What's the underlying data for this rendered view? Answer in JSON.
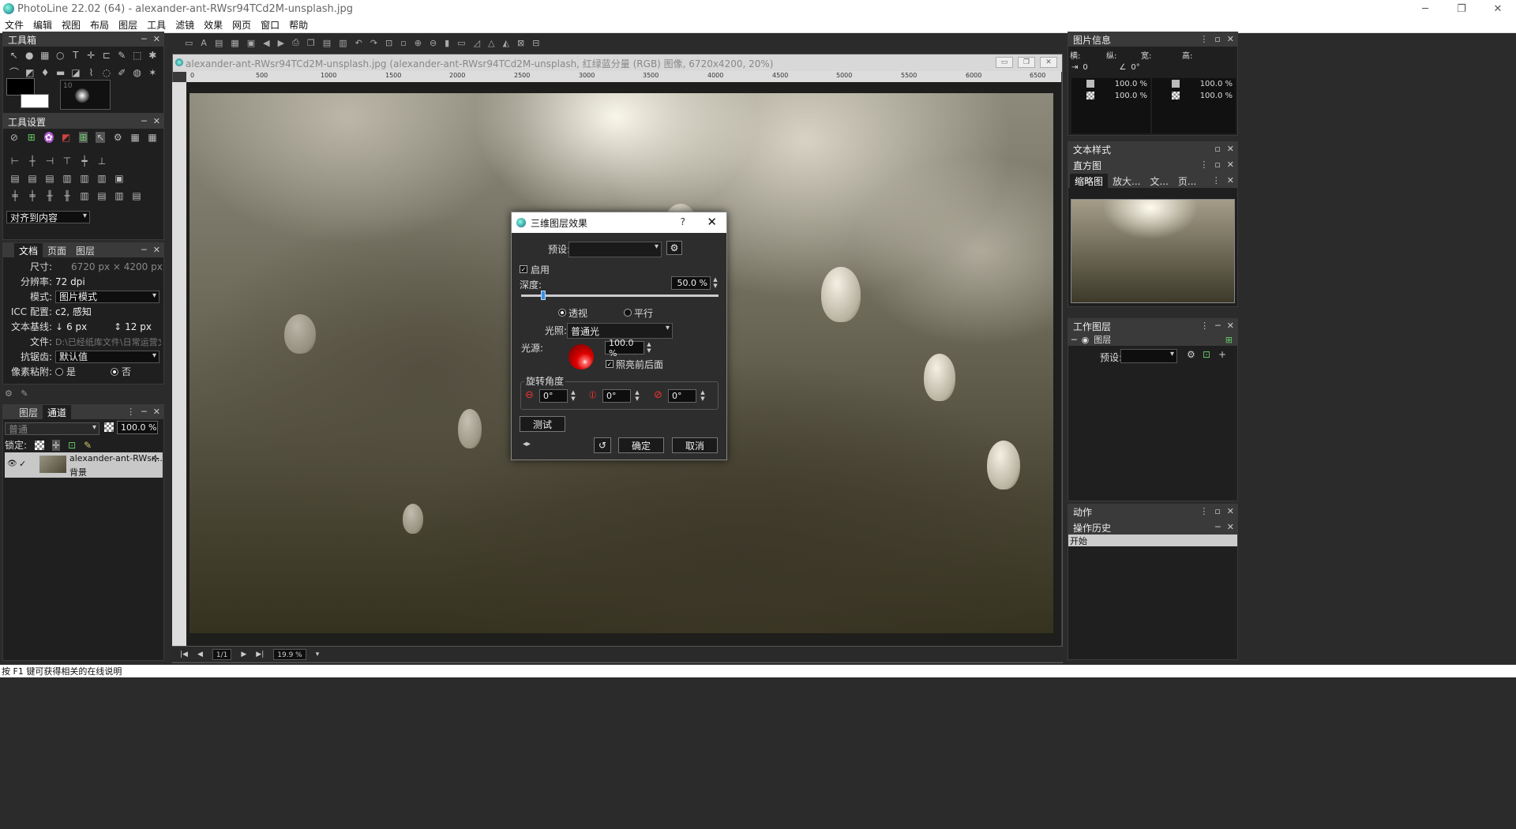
{
  "window": {
    "title": "PhotoLine 22.02 (64) - alexander-ant-RWsr94TCd2M-unsplash.jpg",
    "min": "─",
    "max": "❐",
    "close": "✕"
  },
  "menu": [
    "文件",
    "编辑",
    "视图",
    "布局",
    "图层",
    "工具",
    "滤镜",
    "效果",
    "网页",
    "窗口",
    "帮助"
  ],
  "toolbox": {
    "title": "工具箱",
    "brush_size": "10"
  },
  "tool_settings": {
    "title": "工具设置",
    "align_to": "对齐到内容"
  },
  "doc_props": {
    "tabs": [
      "文档",
      "页面",
      "图层"
    ],
    "size_label": "尺寸:",
    "size_value": "6720 px × 4200 px",
    "res_label": "分辨率:",
    "res_value": "72 dpi",
    "mode_label": "模式:",
    "mode_value": "图片模式",
    "icc_label": "ICC 配置:",
    "icc_value": "c2, 感知",
    "baseline_label": "文本基线:",
    "baseline_a": "6 px",
    "baseline_b": "12 px",
    "file_label": "文件:",
    "file_value": "D:\\已经纸库文件\\日常运营文件\\",
    "aa_label": "抗锯齿:",
    "aa_value": "默认值",
    "snap_label": "像素粘附:",
    "snap_yes": "是",
    "snap_no": "否"
  },
  "layers": {
    "tabs": [
      "图层",
      "通道"
    ],
    "blend": "普通",
    "opacity": "100.0 %",
    "lock_label": "锁定:",
    "layer_name": "alexander-ant-RWsr...",
    "layer_sub": "背景"
  },
  "document": {
    "title": "alexander-ant-RWsr94TCd2M-unsplash.jpg (alexander-ant-RWsr94TCd2M-unsplash, 红绿蓝分量 (RGB) 图像, 6720x4200, 20%)",
    "ruler": [
      "0",
      "500",
      "1000",
      "1500",
      "2000",
      "2500",
      "3000",
      "3500",
      "4000",
      "4500",
      "5000",
      "5500",
      "6000",
      "6500"
    ],
    "page": "1/1",
    "zoom": "19.9 %"
  },
  "dialog": {
    "title": "三维图层效果",
    "help": "?",
    "close": "✕",
    "preset_label": "预设:",
    "enable_label": "启用",
    "depth_label": "深度:",
    "depth_value": "50.0 %",
    "depth_level": 0.1,
    "persp_label": "透视",
    "parallel_label": "平行",
    "light_label": "光照:",
    "light_value": "普通光",
    "source_label": "光源:",
    "source_value": "100.0 %",
    "front_label": "照亮前后面",
    "rotate_label": "旋转角度",
    "rot": [
      "0°",
      "0°",
      "0°"
    ],
    "test": "测试",
    "ok": "确定",
    "cancel": "取消"
  },
  "right": {
    "imginfo": {
      "title": "图片信息",
      "h": "横:",
      "v": "纵:",
      "w": "宽:",
      "ht": "高:",
      "dist": "0",
      "angle": "0°",
      "rows": [
        "100.0 %",
        "100.0 %",
        "100.0 %",
        "100.0 %"
      ]
    },
    "textstyle": "文本样式",
    "histogram": "直方图",
    "nav_tabs": [
      "缩略图",
      "放大...",
      "文...",
      "页..."
    ],
    "worklayer": {
      "title": "工作图层",
      "layer": "图层",
      "preset_label": "预设:"
    },
    "actions": "动作",
    "history": {
      "title": "操作历史",
      "item": "开始"
    }
  },
  "status": "按 F1 键可获得相关的在线说明"
}
